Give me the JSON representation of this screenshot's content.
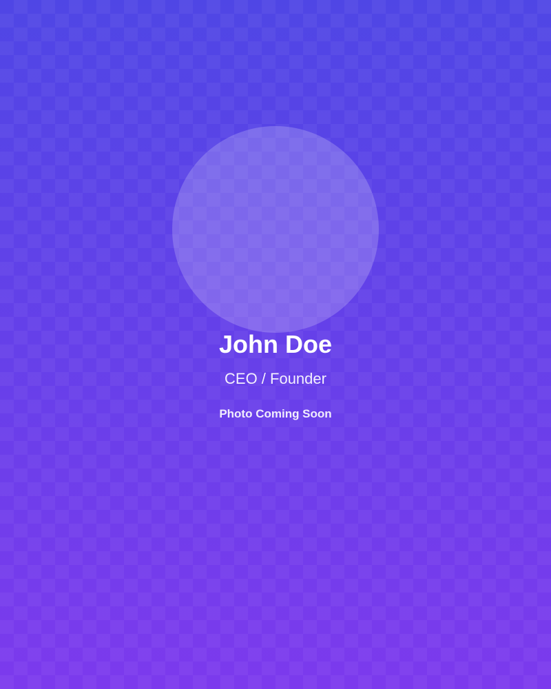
{
  "profile": {
    "name": "John Doe",
    "role": "CEO / Founder",
    "photo_note": "Photo Coming Soon"
  },
  "colors": {
    "gradient_top": "#4f46e5",
    "gradient_bottom": "#7c3aed",
    "text": "#ffffff"
  }
}
